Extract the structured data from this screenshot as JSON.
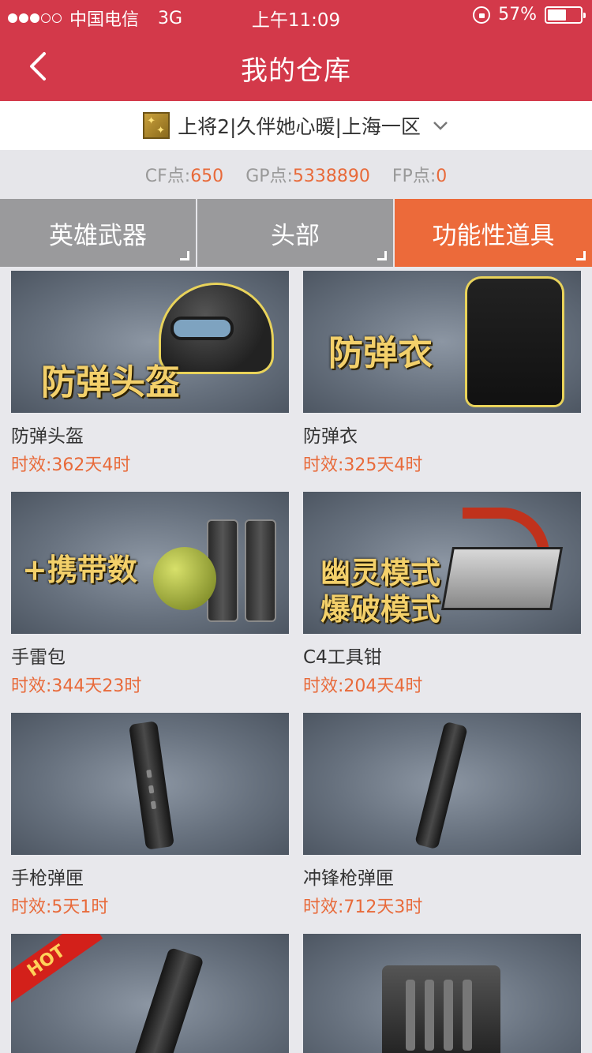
{
  "status_bar": {
    "carrier": "中国电信",
    "network": "3G",
    "time": "上午11:09",
    "battery_percent": "57%",
    "battery_level": 0.57,
    "signal_dots_filled": 3,
    "signal_dots_total": 5
  },
  "nav": {
    "title": "我的仓库",
    "back_icon": "chevron-left-icon"
  },
  "account": {
    "name": "上将2|久伴她心暖|上海一区",
    "rank_icon": "rank-badge-icon",
    "dropdown_icon": "chevron-down-icon"
  },
  "points": [
    {
      "label": "CF点:",
      "value": "650"
    },
    {
      "label": "GP点:",
      "value": "5338890"
    },
    {
      "label": "FP点:",
      "value": "0"
    }
  ],
  "tabs": [
    {
      "label": "英雄武器",
      "active": false
    },
    {
      "label": "头部",
      "active": false
    },
    {
      "label": "功能性道具",
      "active": true
    }
  ],
  "items": [
    {
      "name": "防弹头盔",
      "time": "时效:362天4时",
      "art_text": "防弹头盔"
    },
    {
      "name": "防弹衣",
      "time": "时效:325天4时",
      "art_text": "防弹衣"
    },
    {
      "name": "手雷包",
      "time": "时效:344天23时",
      "art_text": "+携带数"
    },
    {
      "name": "C4工具钳",
      "time": "时效:204天4时",
      "art_text_1": "幽灵模式",
      "art_text_2": "爆破模式"
    },
    {
      "name": "手枪弹匣",
      "time": "时效:5天1时"
    },
    {
      "name": "冲锋枪弹匣",
      "time": "时效:712天3时"
    },
    {
      "badge": "HOT"
    },
    {}
  ],
  "colors": {
    "header": "#d3394a",
    "accent": "#ec6a3a",
    "tab_inactive": "#9a9a9c"
  }
}
